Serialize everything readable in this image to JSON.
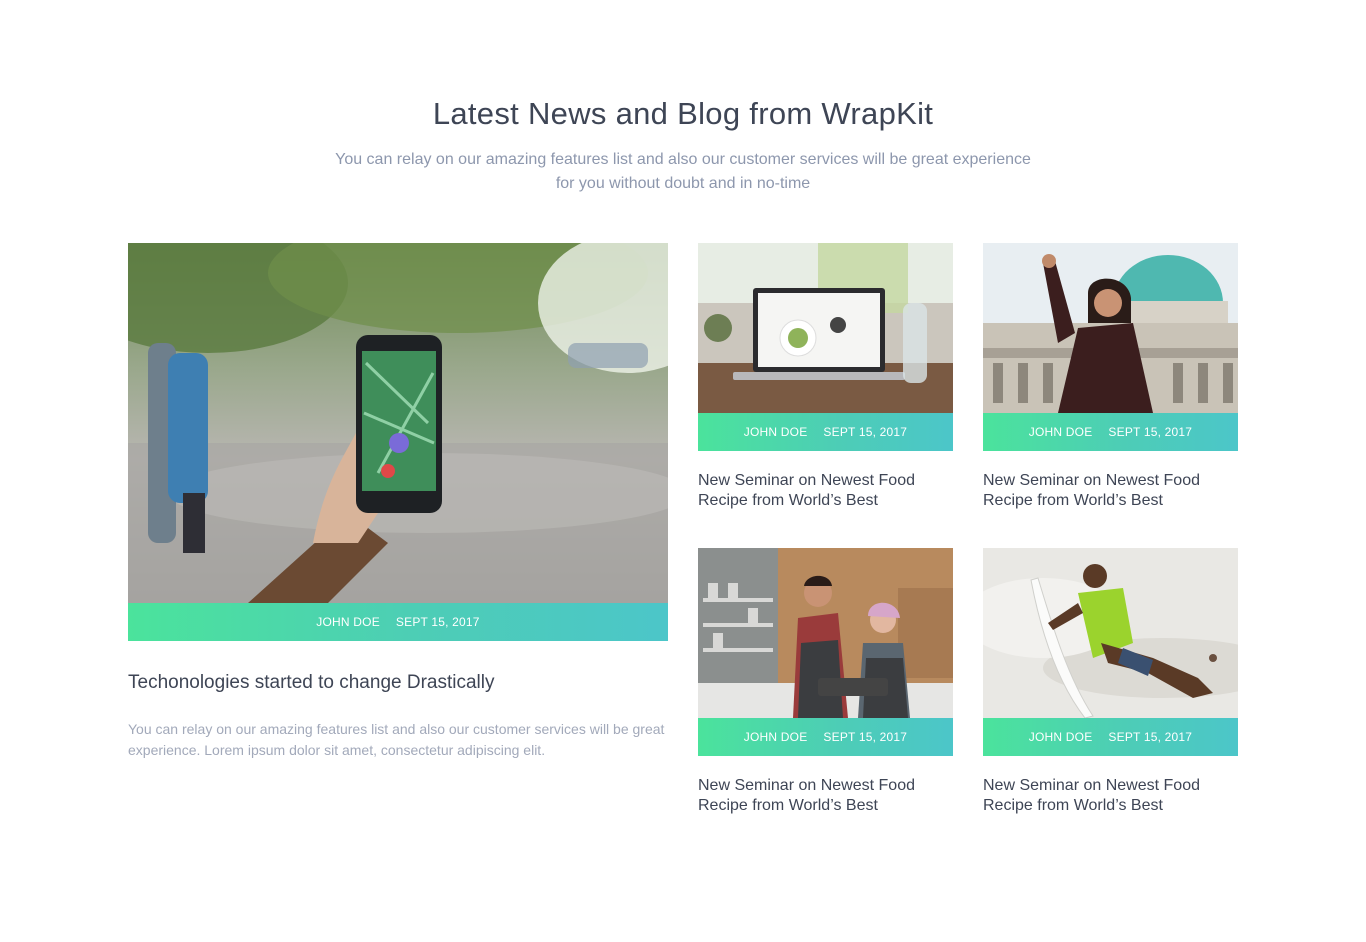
{
  "section": {
    "title": "Latest News and Blog from WrapKit",
    "subtitle": "You can relay on our amazing features list and also our customer services will be great experience for you without doubt and in no-time"
  },
  "featured": {
    "author": "JOHN DOE",
    "date": "SEPT 15, 2017",
    "title": "Techonologies started to change Drastically",
    "description": "You can relay on our amazing features list and also our customer services will be great experience. Lorem ipsum dolor sit amet, consectetur adipiscing elit."
  },
  "posts": [
    {
      "author": "JOHN DOE",
      "date": "SEPT 15, 2017",
      "title": "New Seminar on Newest Food Recipe from World’s Best"
    },
    {
      "author": "JOHN DOE",
      "date": "SEPT 15, 2017",
      "title": "New Seminar on Newest Food Recipe from World’s Best"
    },
    {
      "author": "JOHN DOE",
      "date": "SEPT 15, 2017",
      "title": "New Seminar on Newest Food Recipe from World’s Best"
    },
    {
      "author": "JOHN DOE",
      "date": "SEPT 15, 2017",
      "title": "New Seminar on Newest Food Recipe from World’s Best"
    }
  ],
  "colors": {
    "heading": "#3e4555",
    "muted": "#8d97ad",
    "gradient_start": "#4be39c",
    "gradient_end": "#4cc6c9"
  }
}
